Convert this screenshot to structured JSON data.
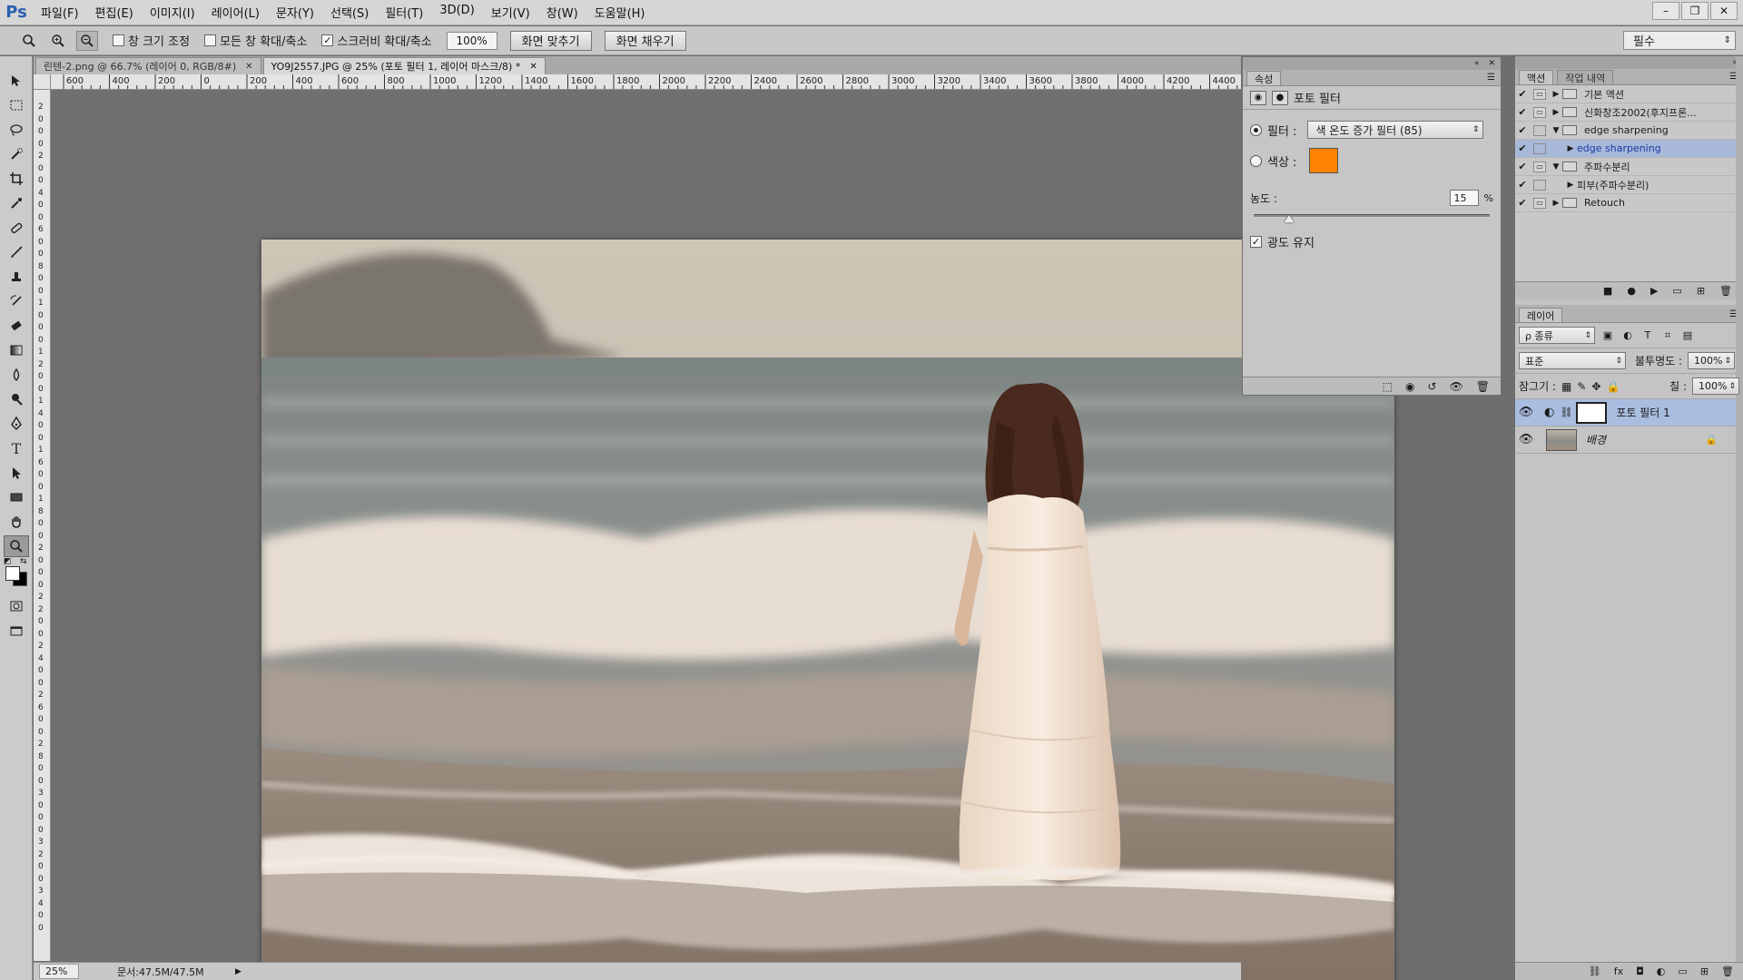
{
  "app": {
    "logo": "Ps",
    "menu": [
      "파일(F)",
      "편집(E)",
      "이미지(I)",
      "레이어(L)",
      "문자(Y)",
      "선택(S)",
      "필터(T)",
      "3D(D)",
      "보기(V)",
      "창(W)",
      "도움말(H)"
    ],
    "window_controls": [
      "–",
      "❐",
      "✕"
    ]
  },
  "options": {
    "fit_window_label": "창 크기 조정",
    "zoom_all_label": "모든 창 확대/축소",
    "scrubby_label": "스크러비 확대/축소",
    "scrubby_checked": true,
    "zoom_value": "100%",
    "fit_screen_btn": "화면 맞추기",
    "fill_screen_btn": "화면 채우기",
    "workspace": "필수"
  },
  "documents": {
    "tabs": [
      {
        "label": "린텐-2.png @ 66.7% (레이어 0, RGB/8#)",
        "active": false
      },
      {
        "label": "YO9J2557.JPG @ 25% (포토 필터 1, 레이어 마스크/8) *",
        "active": true
      }
    ],
    "close_glyph": "✕"
  },
  "rulers": {
    "top_ticks": [
      "600",
      "400",
      "200",
      "0",
      "200",
      "400",
      "600",
      "800",
      "1000",
      "1200",
      "1400",
      "1600",
      "1800",
      "2000",
      "2200",
      "2400",
      "2600",
      "2800",
      "3000",
      "3200",
      "3400",
      "3600",
      "3800",
      "4000",
      "4200",
      "4400"
    ],
    "left_ticks": [
      "2",
      "0",
      "0",
      "0",
      "2",
      "0",
      "0",
      "4",
      "0",
      "0",
      "6",
      "0",
      "0",
      "8",
      "0",
      "0",
      "1",
      "0",
      "0",
      "0",
      "1",
      "2",
      "0",
      "0",
      "1",
      "4",
      "0",
      "0",
      "1",
      "6",
      "0",
      "0",
      "1",
      "8",
      "0",
      "0",
      "2",
      "0",
      "0",
      "0",
      "2",
      "2",
      "0",
      "0",
      "2",
      "4",
      "0",
      "0",
      "2",
      "6",
      "0",
      "0",
      "2",
      "8",
      "0",
      "0",
      "3",
      "0",
      "0",
      "0",
      "3",
      "2",
      "0",
      "0",
      "3",
      "4",
      "0",
      "0"
    ]
  },
  "status": {
    "zoom": "25%",
    "doc_size": "문서:47.5M/47.5M",
    "arrow": "▶"
  },
  "properties": {
    "tab": "속성",
    "header": "포토 필터",
    "filter_label": "필터 :",
    "filter_value": "색 온도 증가 필터 (85)",
    "color_label": "색상 :",
    "color_hex": "#ff8200",
    "density_label": "농도 :",
    "density_value": "15",
    "density_unit": "%",
    "density": 15,
    "preserve_label": "광도 유지",
    "preserve_checked": true
  },
  "actions": {
    "tabs": [
      "액션",
      "작업 내역"
    ],
    "items": [
      {
        "label": "기본 액션",
        "check": "✔",
        "toggle": "▭",
        "expanded": false,
        "indent": 0,
        "selected": false
      },
      {
        "label": "신화창조2002(후지프론...",
        "check": "✔",
        "toggle": "▭",
        "expanded": false,
        "indent": 0,
        "selected": false
      },
      {
        "label": "edge sharpening",
        "check": "✔",
        "toggle": "",
        "expanded": true,
        "indent": 0,
        "selected": false
      },
      {
        "label": "edge sharpening",
        "check": "✔",
        "toggle": "",
        "expanded": false,
        "indent": 1,
        "selected": true
      },
      {
        "label": "주파수분리",
        "check": "✔",
        "toggle": "▭",
        "expanded": true,
        "indent": 0,
        "selected": false
      },
      {
        "label": "피부(주파수분리)",
        "check": "✔",
        "toggle": "",
        "expanded": false,
        "indent": 1,
        "selected": false
      },
      {
        "label": "Retouch",
        "check": "✔",
        "toggle": "▭",
        "expanded": false,
        "indent": 0,
        "selected": false
      }
    ],
    "footer_icons": [
      "■",
      "●",
      "▶",
      "▭",
      "⊞",
      "🗑"
    ]
  },
  "layers": {
    "tab": "레이어",
    "kind_filter": "ρ 종류",
    "blend_mode": "표준",
    "opacity_label": "불투명도 :",
    "opacity_value": "100%",
    "lock_label": "잠그기 :",
    "fill_label": "칠 :",
    "fill_value": "100%",
    "items": [
      {
        "name": "포토 필터 1",
        "visible": true,
        "selected": true,
        "locked": false,
        "italic": false
      },
      {
        "name": "배경",
        "visible": true,
        "selected": false,
        "locked": true,
        "italic": true
      }
    ],
    "footer_icons": [
      "⛓",
      "fx",
      "◘",
      "◐",
      "▭",
      "⊞",
      "🗑"
    ]
  },
  "colors": {
    "accent": "#ff8200",
    "selection": "#a9bde0"
  }
}
